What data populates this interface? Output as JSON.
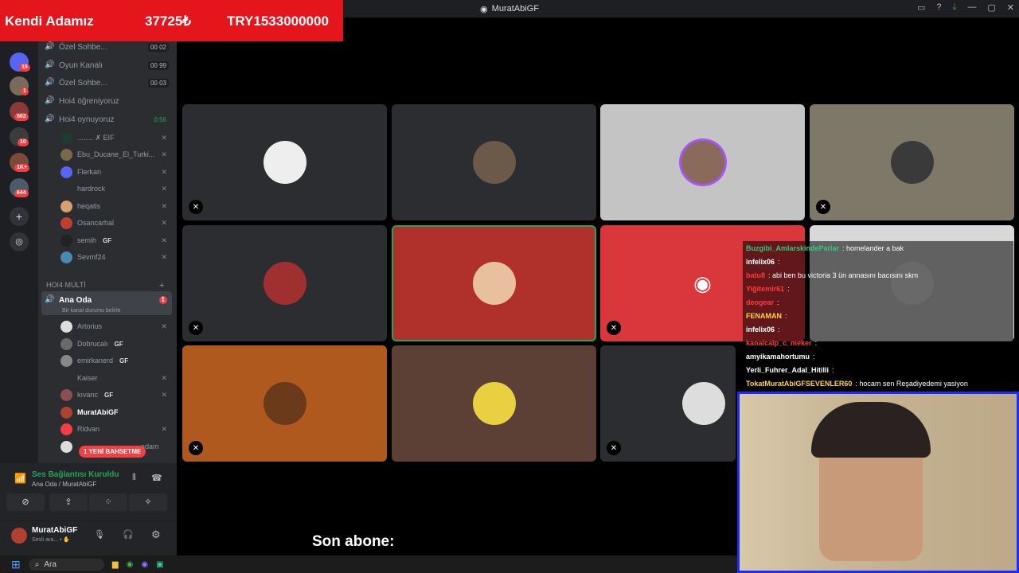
{
  "window": {
    "title": "MuratAbiGF"
  },
  "banner": {
    "name": "Kendi Adamız",
    "amount": "37725₺",
    "total": "TRY1533000000"
  },
  "servers": [
    {
      "badge": "15"
    },
    {
      "badge": "1"
    },
    {
      "badge": "563"
    },
    {
      "badge": "10"
    },
    {
      "badge": "1K+"
    },
    {
      "badge": "644"
    }
  ],
  "channels": {
    "top": [
      {
        "label": "Özel Sohbe...",
        "count": "00 02"
      },
      {
        "label": "Oyun Kanalı",
        "count": "00 99"
      },
      {
        "label": "Özel Sohbe...",
        "count": "00 03"
      },
      {
        "label": "Hoi4 öğreniyoruz",
        "count": ""
      },
      {
        "label": "Hoi4 oynuyoruz",
        "count": "0:56"
      }
    ],
    "hoi4_members": [
      {
        "name": "........ ✗ EIF",
        "tag": ""
      },
      {
        "name": "Ebu_Ducane_El_Turki...",
        "tag": ""
      },
      {
        "name": "Flerkan",
        "tag": ""
      },
      {
        "name": "hardrock",
        "tag": ""
      },
      {
        "name": "heqatis",
        "tag": ""
      },
      {
        "name": "Osancarhal",
        "tag": ""
      },
      {
        "name": "semih",
        "tag": "GF"
      },
      {
        "name": "Sevmf24",
        "tag": ""
      }
    ],
    "section": "HOI4 MULTİ",
    "active": {
      "label": "Ana Oda",
      "status": "Bir kanal durumu belirle",
      "badge": "1"
    },
    "ana_members": [
      {
        "name": "Artorius",
        "tag": ""
      },
      {
        "name": "Dobrucalı",
        "tag": "GF"
      },
      {
        "name": "emirkanerd",
        "tag": "GF"
      },
      {
        "name": "Kaiser",
        "tag": ""
      },
      {
        "name": "kıvanc",
        "tag": "GF"
      },
      {
        "name": "MuratAbiGF",
        "tag": ""
      },
      {
        "name": "Ridvan",
        "tag": ""
      },
      {
        "name": "adam",
        "tag": ""
      }
    ],
    "mention": "1 YENİ BAHSETME"
  },
  "voice": {
    "status": "Ses Bağlantısı Kuruldu",
    "channel": "Ana Oda / MuratAbiGF"
  },
  "user": {
    "name": "MuratAbiGF",
    "status": "Sesli ara... • ✋"
  },
  "chat": [
    {
      "name": "Buzgibi_AmlarskindeParlar",
      "msg": ": homelander a bak",
      "color": "#32c87c"
    },
    {
      "name": "infelix06",
      "msg": ":",
      "color": "#ffffff"
    },
    {
      "name": "batu8",
      "msg": ": abi ben bu victoria 3 ün annasını bacısını skm",
      "color": "#ff3b3b"
    },
    {
      "name": "Yiğitemir61",
      "msg": ":",
      "color": "#ff3b3b"
    },
    {
      "name": "deogear",
      "msg": ":",
      "color": "#ff3b3b"
    },
    {
      "name": "FENAMAN",
      "msg": ":",
      "color": "#ffd43b"
    },
    {
      "name": "infelix06",
      "msg": ":",
      "color": "#ffffff"
    },
    {
      "name": "kanalcalp_c_meker",
      "msg": ":",
      "color": "#ff3b3b"
    },
    {
      "name": "amyikamahortumu",
      "msg": ":",
      "color": "#ffffff"
    },
    {
      "name": "Yerli_Fuhrer_Adal_Hitilli",
      "msg": ":",
      "color": "#ffffff"
    },
    {
      "name": "TokatMuratAbiGFSEVENLER60",
      "msg": ": hocam sen Reşadiyedemi yasiyon",
      "color": "#ffd43b"
    }
  ],
  "subtitle": "Son abone:",
  "taskbar": {
    "search": "Ara"
  },
  "colors": {
    "discord": "#5865f2",
    "red_tile": "#b0312c",
    "orange_tile": "#b0591e",
    "brown_tile": "#5c4036",
    "pink_tile": "#da373c"
  }
}
